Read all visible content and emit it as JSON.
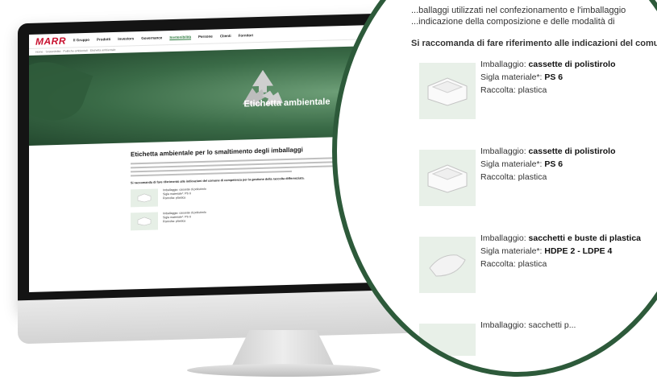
{
  "site": {
    "logo": "MARR",
    "nav": [
      "Il Gruppo",
      "Prodotti",
      "Investors",
      "Governance",
      "Sostenibilità",
      "Persone",
      "Clienti",
      "Fornitori"
    ],
    "breadcrumb": "Home · Sostenibilità · Politiche ambientali · Etichetta ambientale",
    "hero_title": "Etichetta ambientale",
    "section_title": "Etichetta ambientale per lo smaltimento degli imballaggi",
    "recommend": "Si raccomanda di fare riferimento alle indicazioni del comune di competenza per la gestione della raccolta differenziata.",
    "mini_items": [
      {
        "packaging": "Imballaggio: cassette di polistirolo",
        "material": "Sigla materiale*: PS 6",
        "collection": "Raccolta: plastica"
      },
      {
        "packaging": "Imballaggio: cassette di polistirolo",
        "material": "Sigla materiale*: PS 6",
        "collection": "Raccolta: plastica"
      }
    ]
  },
  "magnifier": {
    "line1": "...ballaggi utilizzati nel confezionamento e l'imballaggio",
    "line2": "...indicazione della composizione e delle modalità di",
    "recommend": "Si raccomanda di fare riferimento alle indicazioni del comune",
    "items": [
      {
        "label_packaging": "Imballaggio: ",
        "packaging": "cassette di polistirolo",
        "label_material": "Sigla materiale*: ",
        "material": "PS 6",
        "collection": "Raccolta: plastica"
      },
      {
        "label_packaging": "Imballaggio: ",
        "packaging": "cassette di polistirolo",
        "label_material": "Sigla materiale*: ",
        "material": "PS 6",
        "collection": "Raccolta: plastica"
      },
      {
        "label_packaging": "Imballaggio: ",
        "packaging": "sacchetti e buste di plastica",
        "label_material": "Sigla materiale*: ",
        "material": "HDPE 2 - LDPE 4",
        "collection": "Raccolta: plastica"
      }
    ],
    "partial_item": "Imballaggio: sacchetti p..."
  }
}
